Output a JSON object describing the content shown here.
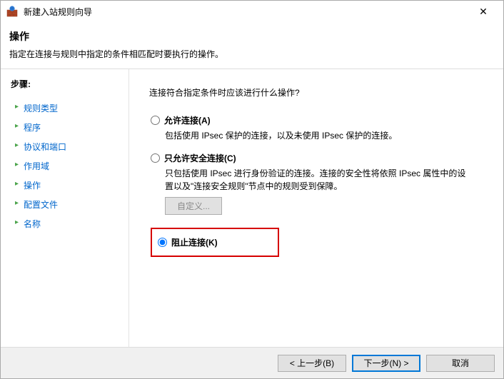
{
  "titlebar": {
    "title": "新建入站规则向导",
    "close": "✕"
  },
  "header": {
    "title": "操作",
    "desc": "指定在连接与规则中指定的条件相匹配时要执行的操作。"
  },
  "sidebar": {
    "title": "步骤:",
    "items": [
      {
        "label": "规则类型"
      },
      {
        "label": "程序"
      },
      {
        "label": "协议和端口"
      },
      {
        "label": "作用域"
      },
      {
        "label": "操作"
      },
      {
        "label": "配置文件"
      },
      {
        "label": "名称"
      }
    ]
  },
  "main": {
    "question": "连接符合指定条件时应该进行什么操作?",
    "options": {
      "allow": {
        "label": "允许连接(A)",
        "desc": "包括使用 IPsec 保护的连接，以及未使用 IPsec 保护的连接。"
      },
      "allow_secure": {
        "label": "只允许安全连接(C)",
        "desc": "只包括使用 IPsec 进行身份验证的连接。连接的安全性将依照 IPsec 属性中的设置以及\"连接安全规则\"节点中的规则受到保障。",
        "custom_btn": "自定义..."
      },
      "block": {
        "label": "阻止连接(K)"
      }
    }
  },
  "footer": {
    "back": "< 上一步(B)",
    "next": "下一步(N) >",
    "cancel": "取消"
  }
}
